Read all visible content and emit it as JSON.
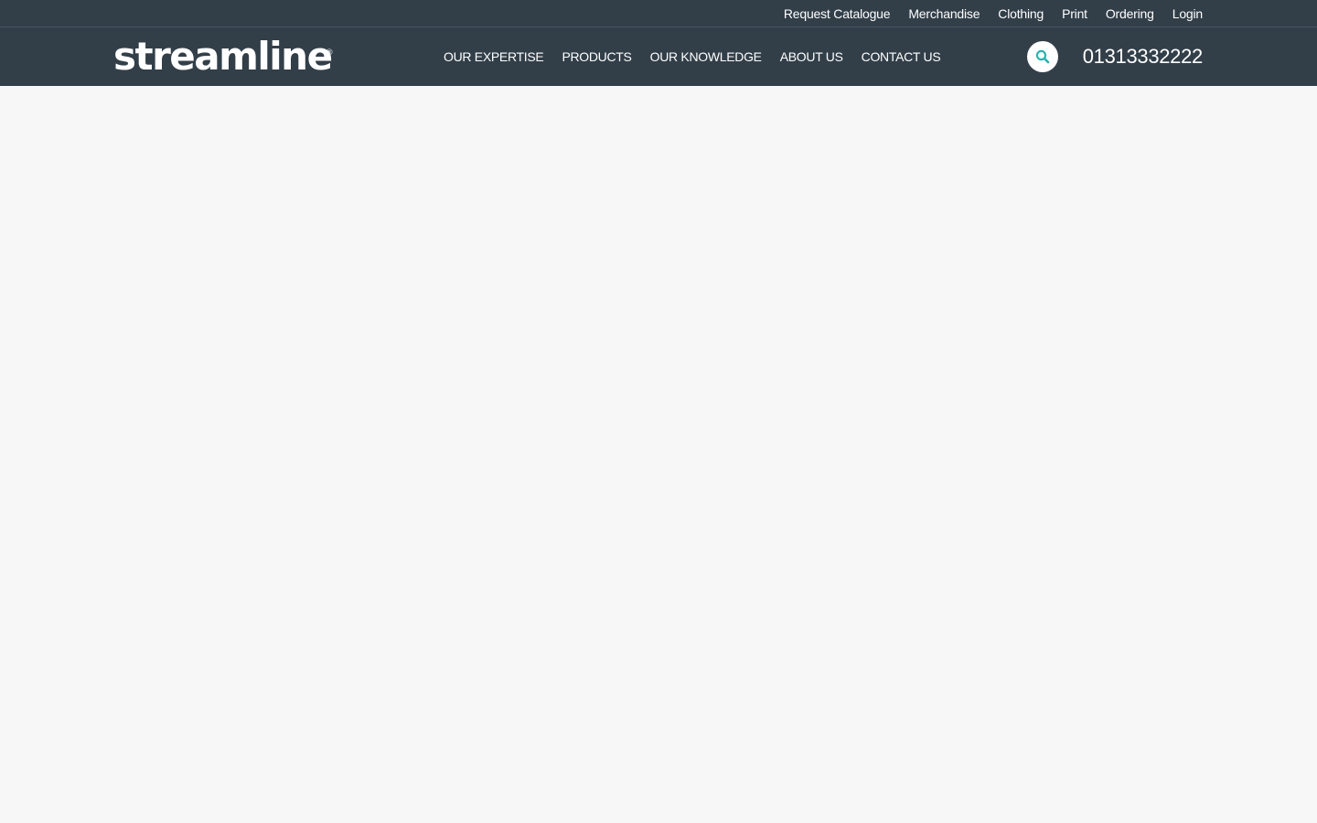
{
  "utility_nav": {
    "items": [
      {
        "label": "Request Catalogue"
      },
      {
        "label": "Merchandise"
      },
      {
        "label": "Clothing"
      },
      {
        "label": "Print"
      },
      {
        "label": "Ordering"
      },
      {
        "label": "Login"
      }
    ]
  },
  "header": {
    "logo_text": "streamline",
    "logo_mark": "®",
    "phone": "01313332222",
    "search_icon": "search-icon"
  },
  "primary_nav": {
    "items": [
      {
        "label": "OUR EXPERTISE"
      },
      {
        "label": "PRODUCTS"
      },
      {
        "label": "OUR KNOWLEDGE"
      },
      {
        "label": "ABOUT US"
      },
      {
        "label": "CONTACT US"
      }
    ]
  },
  "colors": {
    "header_bg": "#323f49",
    "page_bg": "#f7f7f7",
    "accent": "#2ab3b1",
    "text_light": "#ffffff"
  }
}
